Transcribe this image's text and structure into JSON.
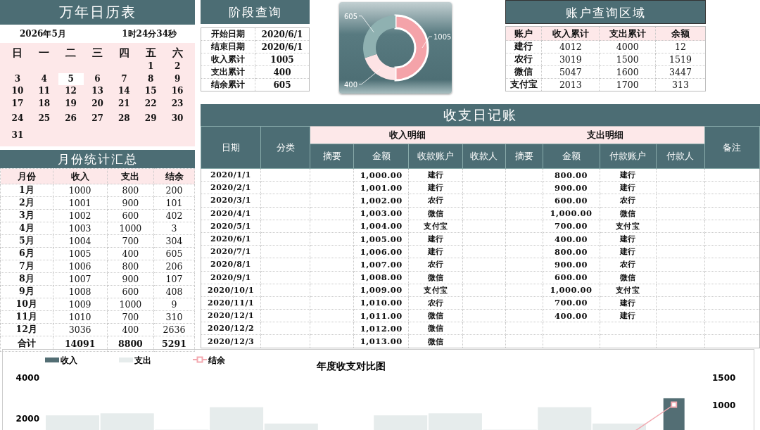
{
  "calendar": {
    "title": "万年日历表",
    "month": "2026年5月",
    "time": "1时24分34秒",
    "weekdays": [
      "日",
      "一",
      "二",
      "三",
      "四",
      "五",
      "六"
    ],
    "weeks": [
      [
        {
          "day": "1",
          "selected": false
        },
        {
          "day": "2",
          "selected": false
        }
      ],
      [
        {
          "day": "3",
          "selected": false
        },
        {
          "day": "4",
          "selected": false
        },
        {
          "day": "5",
          "selected": true
        },
        {
          "day": "6",
          "selected": false
        },
        {
          "day": "7",
          "selected": false
        },
        {
          "day": "8",
          "selected": false
        },
        {
          "day": "9",
          "selected": false
        }
      ],
      [
        {
          "day": "10",
          "selected": false
        },
        {
          "day": "11",
          "selected": false
        },
        {
          "day": "12",
          "selected": false
        },
        {
          "day": "13",
          "selected": false
        },
        {
          "day": "14",
          "selected": false
        },
        {
          "day": "15",
          "selected": false
        },
        {
          "day": "16",
          "selected": false
        }
      ],
      [
        {
          "day": "17",
          "selected": false
        },
        {
          "day": "18",
          "selected": false
        },
        {
          "day": "19",
          "selected": false
        },
        {
          "day": "20",
          "selected": false
        },
        {
          "day": "21",
          "selected": false
        },
        {
          "day": "22",
          "selected": false
        },
        {
          "day": "23",
          "selected": false
        }
      ],
      [
        {
          "day": "24",
          "selected": false
        },
        {
          "day": "25",
          "selected": false
        },
        {
          "day": "26",
          "selected": false
        },
        {
          "day": "27",
          "selected": false
        },
        {
          "day": "28",
          "selected": false
        },
        {
          "day": "29",
          "selected": false
        },
        {
          "day": "30",
          "selected": false
        }
      ],
      [
        {
          "day": "31",
          "selected": false
        }
      ]
    ]
  },
  "monthly_summary": {
    "title": "月份统计汇总",
    "columns": [
      "月份",
      "收入",
      "支出",
      "结余"
    ],
    "rows": [
      [
        "1月",
        "1000",
        "800",
        "200"
      ],
      [
        "2月",
        "1001",
        "900",
        "101"
      ],
      [
        "3月",
        "1002",
        "600",
        "402"
      ],
      [
        "4月",
        "1003",
        "1000",
        "3"
      ],
      [
        "5月",
        "1004",
        "700",
        "304"
      ],
      [
        "6月",
        "1005",
        "400",
        "605"
      ],
      [
        "7月",
        "1006",
        "800",
        "206"
      ],
      [
        "8月",
        "1007",
        "900",
        "107"
      ],
      [
        "9月",
        "1008",
        "600",
        "408"
      ],
      [
        "10月",
        "1009",
        "1000",
        "9"
      ],
      [
        "11月",
        "1010",
        "700",
        "310"
      ],
      [
        "12月",
        "3036",
        "400",
        "2636"
      ]
    ],
    "total": [
      "合计",
      "14091",
      "8800",
      "5291"
    ]
  },
  "period_query": {
    "title": "阶段查询",
    "rows": [
      [
        "开始日期",
        "2020/6/1"
      ],
      [
        "结束日期",
        "2020/6/1"
      ],
      [
        "收入累计",
        "1005"
      ],
      [
        "支出累计",
        "400"
      ],
      [
        "结余累计",
        "605"
      ]
    ]
  },
  "period_chart": {
    "chart_data": {
      "type": "donut",
      "values": [
        1005,
        400,
        605
      ],
      "colors": [
        "#f4a3a9",
        "#fde3e5",
        "#8fb1b1"
      ],
      "data_labels": true
    }
  },
  "account_query": {
    "title": "账户查询区域",
    "columns": [
      "账户",
      "收入累计",
      "支出累计",
      "余额"
    ],
    "rows": [
      [
        "建行",
        "4012",
        "4000",
        "12"
      ],
      [
        "农行",
        "3019",
        "1500",
        "1519"
      ],
      [
        "微信",
        "5047",
        "1600",
        "3447"
      ],
      [
        "支付宝",
        "2013",
        "1700",
        "313"
      ]
    ]
  },
  "ledger": {
    "title": "收支日记账",
    "columns": {
      "date": "日期",
      "category": "分类",
      "income_group": "收入明细",
      "expense_group": "支出明细",
      "note": "备注",
      "income": [
        "摘要",
        "金额",
        "收款账户",
        "收款人"
      ],
      "expense": [
        "摘要",
        "金额",
        "付款账户",
        "付款人"
      ]
    },
    "rows": [
      {
        "date": "2020/1/1",
        "income_amount": "1,000.00",
        "income_account": "建行",
        "expense_amount": "800.00",
        "expense_account": "建行"
      },
      {
        "date": "2020/2/1",
        "income_amount": "1,001.00",
        "income_account": "建行",
        "expense_amount": "900.00",
        "expense_account": "建行"
      },
      {
        "date": "2020/3/1",
        "income_amount": "1,002.00",
        "income_account": "农行",
        "expense_amount": "600.00",
        "expense_account": "农行"
      },
      {
        "date": "2020/4/1",
        "income_amount": "1,003.00",
        "income_account": "微信",
        "expense_amount": "1,000.00",
        "expense_account": "微信"
      },
      {
        "date": "2020/5/1",
        "income_amount": "1,004.00",
        "income_account": "支付宝",
        "expense_amount": "700.00",
        "expense_account": "支付宝"
      },
      {
        "date": "2020/6/1",
        "income_amount": "1,005.00",
        "income_account": "建行",
        "expense_amount": "400.00",
        "expense_account": "建行"
      },
      {
        "date": "2020/7/1",
        "income_amount": "1,006.00",
        "income_account": "建行",
        "expense_amount": "800.00",
        "expense_account": "建行"
      },
      {
        "date": "2020/8/1",
        "income_amount": "1,007.00",
        "income_account": "农行",
        "expense_amount": "900.00",
        "expense_account": "农行"
      },
      {
        "date": "2020/9/1",
        "income_amount": "1,008.00",
        "income_account": "微信",
        "expense_amount": "600.00",
        "expense_account": "微信"
      },
      {
        "date": "2020/10/1",
        "income_amount": "1,009.00",
        "income_account": "支付宝",
        "expense_amount": "1,000.00",
        "expense_account": "支付宝"
      },
      {
        "date": "2020/11/1",
        "income_amount": "1,010.00",
        "income_account": "农行",
        "expense_amount": "700.00",
        "expense_account": "建行"
      },
      {
        "date": "2020/12/1",
        "income_amount": "1,011.00",
        "income_account": "微信",
        "expense_amount": "400.00",
        "expense_account": "建行"
      },
      {
        "date": "2020/12/2",
        "income_amount": "1,012.00",
        "income_account": "微信"
      },
      {
        "date": "2020/12/3",
        "income_amount": "1,013.00",
        "income_account": "微信"
      }
    ]
  },
  "annual_chart": {
    "title": "年度收支对比图",
    "legend": [
      {
        "name": "收入",
        "color": "#536e74",
        "kind": "bar"
      },
      {
        "name": "支出",
        "color": "#e6ecec",
        "kind": "bar"
      },
      {
        "name": "结余",
        "color": "#f3a9b0",
        "kind": "line"
      }
    ],
    "left_axis_labels": [
      "4000",
      "2000"
    ],
    "right_axis_labels": [
      "1500",
      "1000"
    ]
  }
}
